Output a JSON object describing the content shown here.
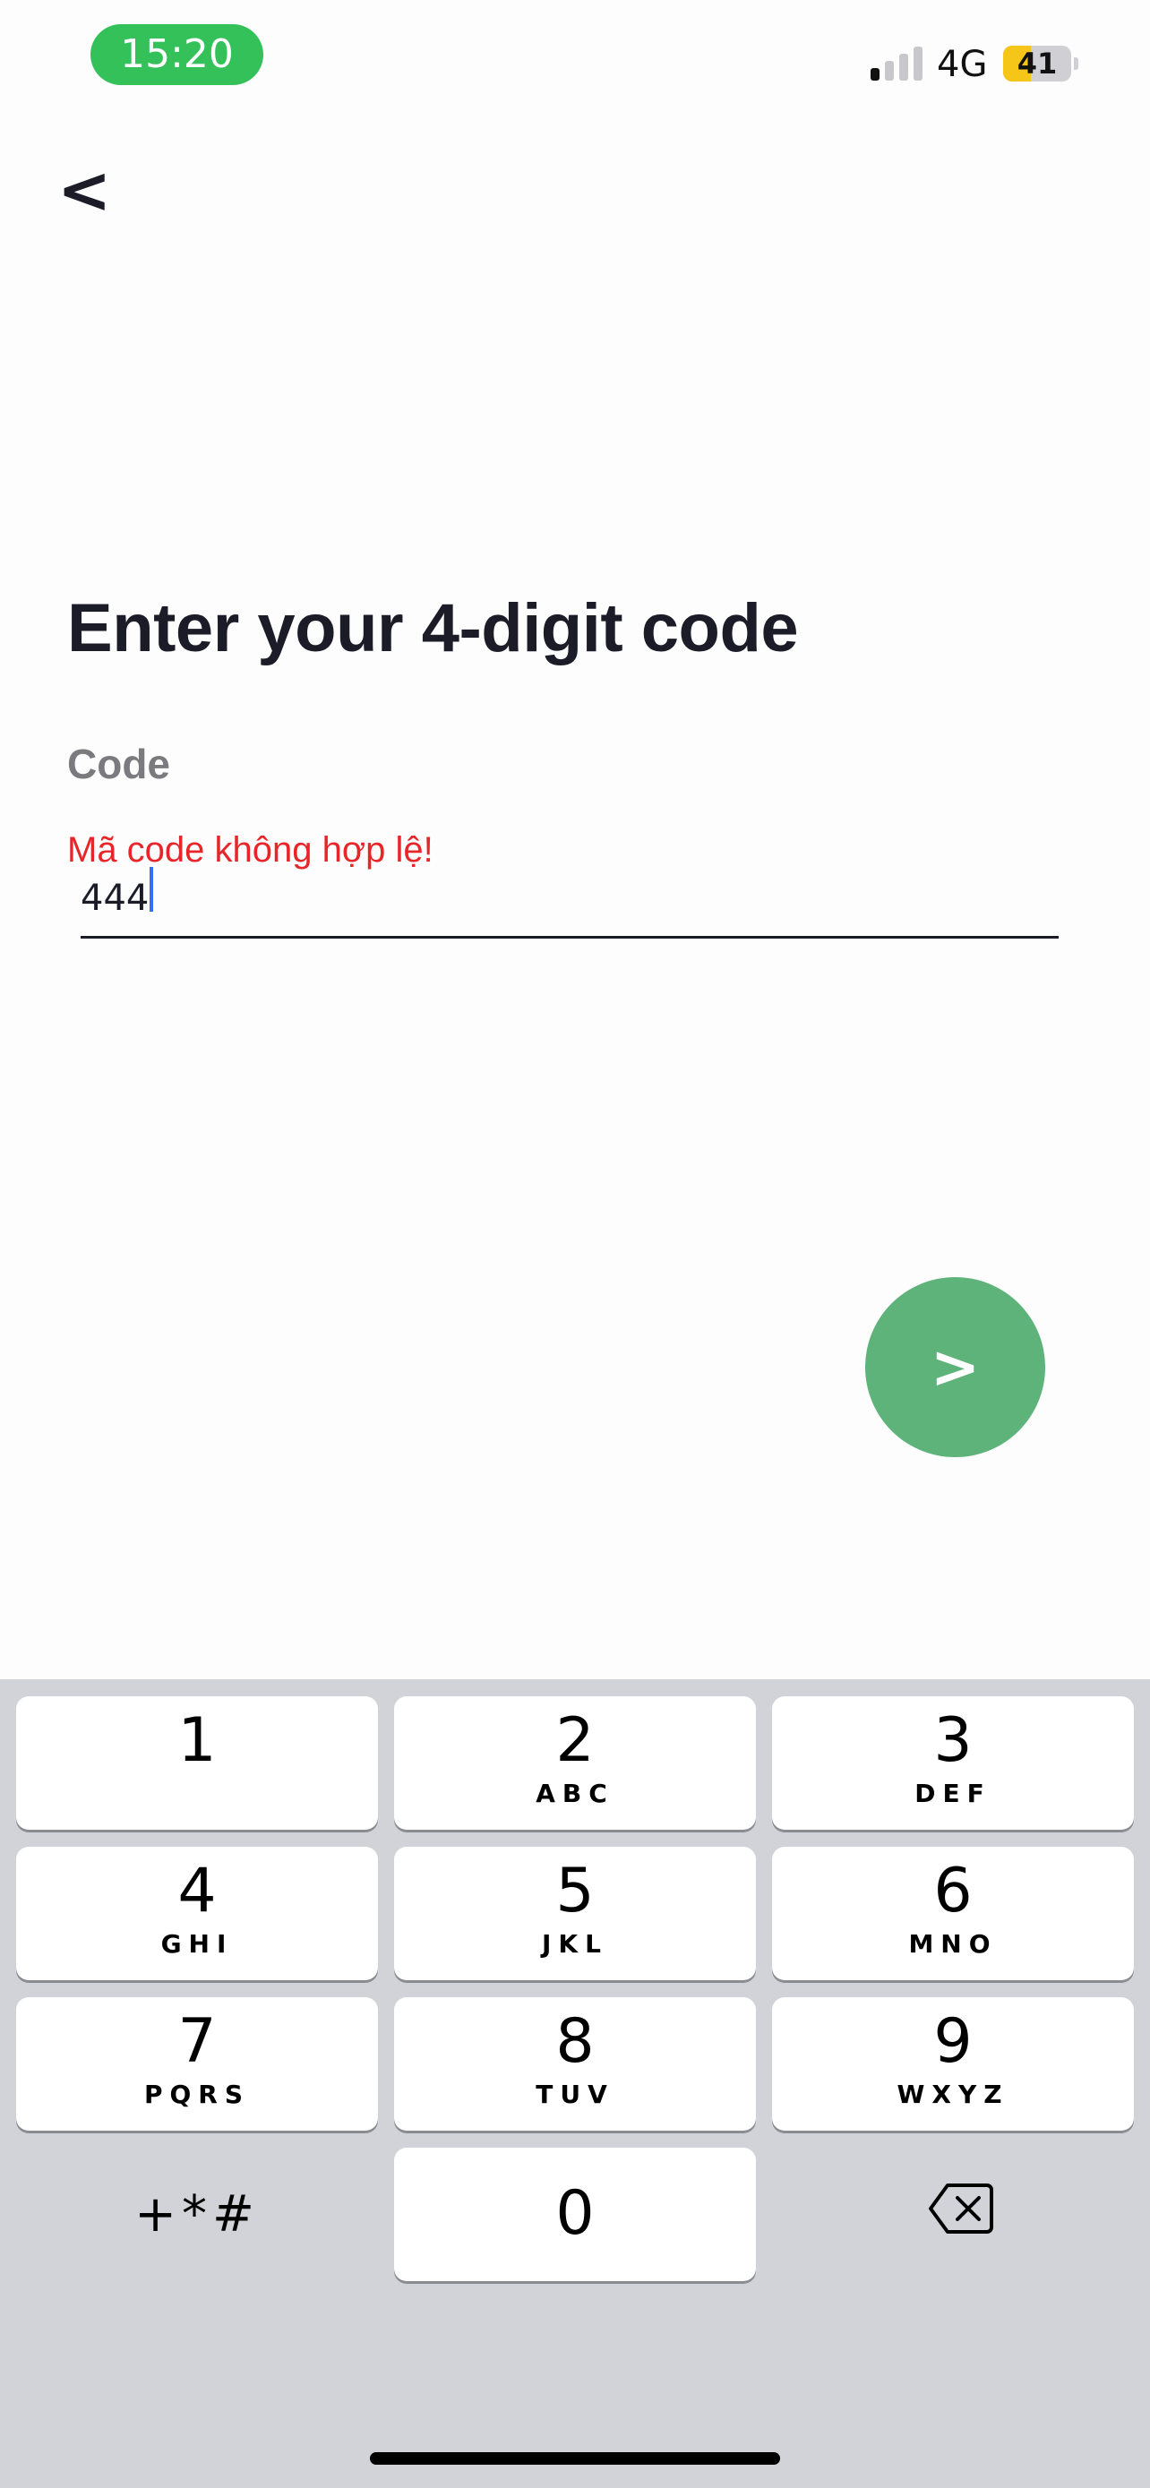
{
  "status_bar": {
    "time": "15:20",
    "network": "4G",
    "battery": "41",
    "battery_level_percent": 41,
    "time_pill_color": "#34c15a",
    "battery_fill_color": "#f5c517"
  },
  "header": {
    "back_label": "<"
  },
  "main": {
    "title": "Enter your 4-digit code",
    "field_label": "Code",
    "error_message": "Mã code không hợp lệ!",
    "code_value": "444",
    "next_label": ">",
    "next_button_color": "#5eb37a",
    "error_color": "#e8262a"
  },
  "keypad": {
    "keys": [
      {
        "digit": "1",
        "letters": ""
      },
      {
        "digit": "2",
        "letters": "ABC"
      },
      {
        "digit": "3",
        "letters": "DEF"
      },
      {
        "digit": "4",
        "letters": "GHI"
      },
      {
        "digit": "5",
        "letters": "JKL"
      },
      {
        "digit": "6",
        "letters": "MNO"
      },
      {
        "digit": "7",
        "letters": "PQRS"
      },
      {
        "digit": "8",
        "letters": "TUV"
      },
      {
        "digit": "9",
        "letters": "WXYZ"
      },
      {
        "digit": "0",
        "letters": ""
      }
    ],
    "symbols_label": "+*#",
    "backspace_icon": "backspace-icon"
  }
}
